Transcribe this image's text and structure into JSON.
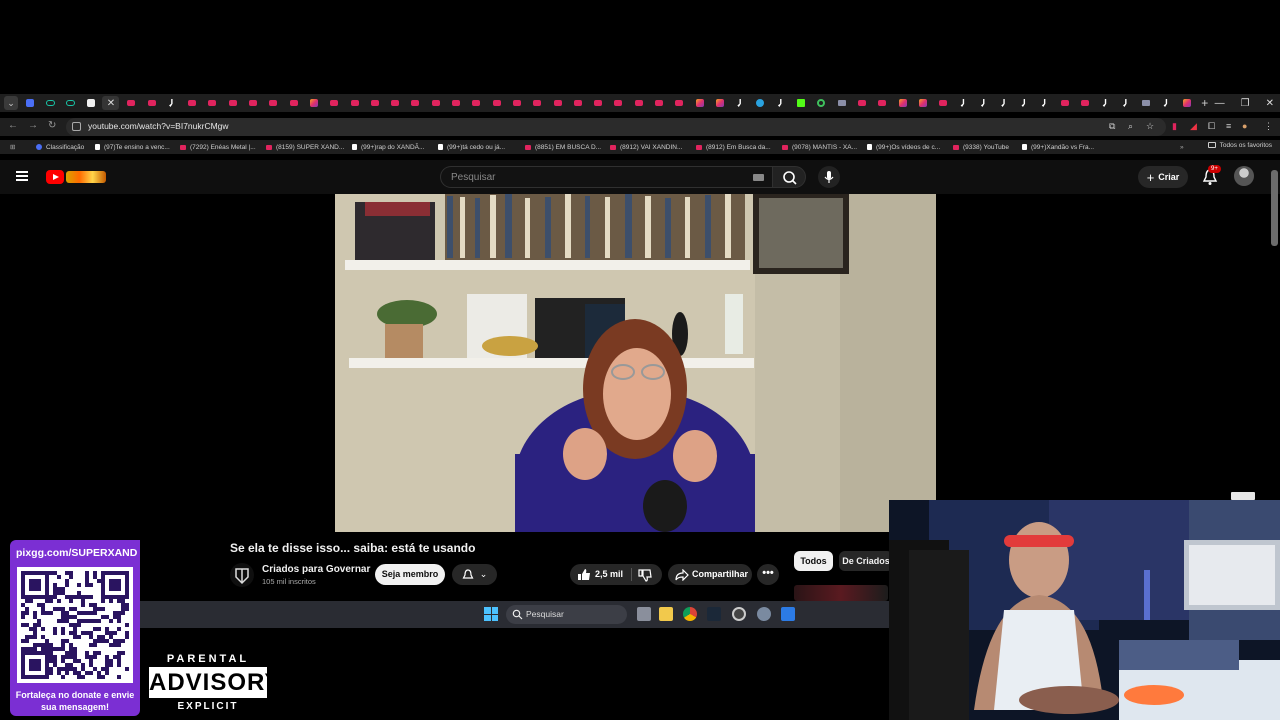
{
  "browser": {
    "url": "youtube.com/watch?v=BI7nukrCMgw",
    "tab_favicons": [
      "blue",
      "cyan",
      "cyan",
      "white",
      "active",
      "yt",
      "yt",
      "tt",
      "yt",
      "yt",
      "yt",
      "yt",
      "yt",
      "yt",
      "ig",
      "yt",
      "yt",
      "yt",
      "yt",
      "yt",
      "yt",
      "yt",
      "yt",
      "yt",
      "yt",
      "yt",
      "yt",
      "yt",
      "yt",
      "yt",
      "yt",
      "yt",
      "yt",
      "ig",
      "ig",
      "tt",
      "tg",
      "tt",
      "kk",
      "gr",
      "gy",
      "yt",
      "yt",
      "ig",
      "ig",
      "yt",
      "tt",
      "tt",
      "tt",
      "tt",
      "tt",
      "yt",
      "yt",
      "tt",
      "tt",
      "gy",
      "tt",
      "ig"
    ],
    "new_tab_icon": "plus-icon",
    "window_controls": [
      "minimize-icon",
      "restore-icon",
      "close-icon"
    ],
    "bookmarks": [
      {
        "label": "Classificação",
        "icon": "gl"
      },
      {
        "label": "(97)Te ensino a venc...",
        "icon": "tt"
      },
      {
        "label": "(7292) Enéas Metal |...",
        "icon": "yt"
      },
      {
        "label": "(8159) SUPER XAND...",
        "icon": "yt"
      },
      {
        "label": "(99+)rap do XANDÃ...",
        "icon": "tt"
      },
      {
        "label": "(99+)tá cedo ou já...",
        "icon": "tt"
      },
      {
        "label": "(8851) EM BUSCA D...",
        "icon": "yt"
      },
      {
        "label": "(8912) VAI XANDIN...",
        "icon": "yt"
      },
      {
        "label": "(8912) Em Busca da...",
        "icon": "yt"
      },
      {
        "label": "(9078) MANTIS - XA...",
        "icon": "yt"
      },
      {
        "label": "(99+)Os vídeos de c...",
        "icon": "tt"
      },
      {
        "label": "(9338) YouTube",
        "icon": "yt"
      },
      {
        "label": "(99+)Xandão vs Fra...",
        "icon": "tt"
      }
    ],
    "all_bookmarks_label": "Todos os favoritos"
  },
  "youtube": {
    "search_placeholder": "Pesquisar",
    "create_label": "Criar",
    "notification_count": "9+",
    "video_title": "Se ela te disse isso... saiba: está te usando",
    "channel_name": "Criados para Governar",
    "subscribers": "105 mil inscritos",
    "member_button": "Seja membro",
    "likes": "2,5 mil",
    "share_label": "Compartilhar",
    "more_label": "•••",
    "chips": [
      "Todos",
      "De Criados"
    ]
  },
  "taskbar": {
    "search_placeholder": "Pesquisar",
    "apps": [
      "task-view-icon",
      "file-explorer-icon",
      "chrome-icon",
      "steam-icon",
      "obs-icon",
      "settings-icon",
      "app-icon"
    ]
  },
  "stream_overlay": {
    "pix_url": "pixgg.com/SUPERXAND",
    "donate_caption": "Fortaleça no donate e envie sua mensagem!",
    "advisory_top": "PARENTAL",
    "advisory_mid": "ADVISORY",
    "advisory_bottom": "EXPLICIT CONTENT"
  },
  "colors": {
    "youtube_red": "#ff0000",
    "pix_purple": "#7b2fd3",
    "chrome_dark": "#1f1f1f",
    "youtube_bg": "#0f0f0f"
  }
}
